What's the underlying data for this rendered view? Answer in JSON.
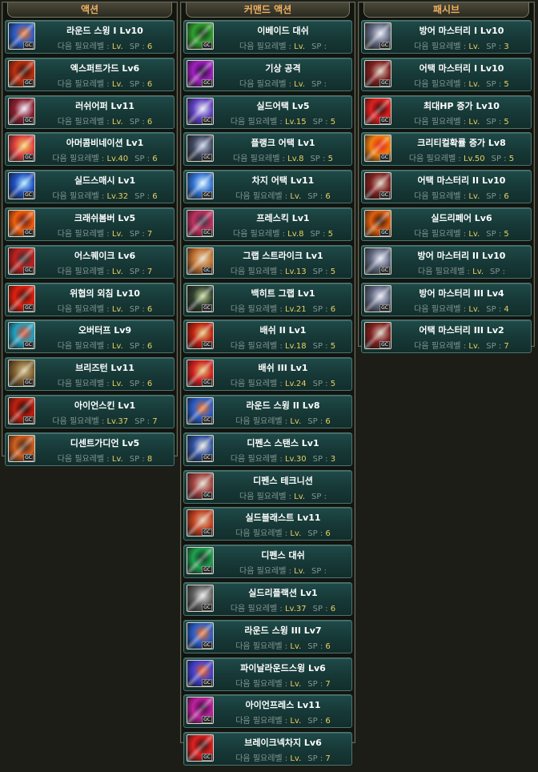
{
  "colors": {
    "title": "#f0b060",
    "skill_name": "#ffffff",
    "req_label": "#7f9693",
    "req_value": "#e8d060"
  },
  "req_label": "다음 필요레벨 :",
  "lv_prefix": "Lv.",
  "sp_label": "SP :",
  "gc_badge": "GC",
  "columns": [
    {
      "title": "액션",
      "skills": [
        {
          "name": "라운드 스윙 I Lv10",
          "lv": "",
          "sp": "6",
          "icon": "sword-swing-icon",
          "c1": "#2a5cc8",
          "c2": "#f07020"
        },
        {
          "name": "엑스퍼트가드 Lv6",
          "lv": "",
          "sp": "6",
          "icon": "guard-icon",
          "c1": "#c03010",
          "c2": "#301008"
        },
        {
          "name": "러쉬어퍼 Lv11",
          "lv": "",
          "sp": "6",
          "icon": "uppercut-icon",
          "c1": "#8a2030",
          "c2": "#e8e0f0"
        },
        {
          "name": "아머콤비네이션 Lv1",
          "lv": "40",
          "sp": "6",
          "icon": "armor-combo-icon",
          "c1": "#e04040",
          "c2": "#f0d060"
        },
        {
          "name": "실드스매시 Lv1",
          "lv": "32",
          "sp": "6",
          "icon": "shield-smash-icon",
          "c1": "#2050c0",
          "c2": "#a0e0ff"
        },
        {
          "name": "크래쉬봄버 Lv5",
          "lv": "",
          "sp": "7",
          "icon": "crash-bomber-icon",
          "c1": "#f06010",
          "c2": "#601008"
        },
        {
          "name": "어스퀘이크 Lv6",
          "lv": "",
          "sp": "7",
          "icon": "earthquake-icon",
          "c1": "#c02020",
          "c2": "#303030"
        },
        {
          "name": "위협의 외침 Lv10",
          "lv": "",
          "sp": "6",
          "icon": "war-cry-icon",
          "c1": "#e02010",
          "c2": "#401008"
        },
        {
          "name": "오버터프 Lv9",
          "lv": "",
          "sp": "6",
          "icon": "overtough-icon",
          "c1": "#20a0c0",
          "c2": "#e04020"
        },
        {
          "name": "브리즈턴 Lv11",
          "lv": "",
          "sp": "6",
          "icon": "breeze-turn-icon",
          "c1": "#806030",
          "c2": "#d0c090"
        },
        {
          "name": "아이언스킨 Lv1",
          "lv": "37",
          "sp": "7",
          "icon": "iron-skin-icon",
          "c1": "#c02010",
          "c2": "#200808"
        },
        {
          "name": "디센트가디언 Lv5",
          "lv": "",
          "sp": "8",
          "icon": "decent-guardian-icon",
          "c1": "#d06020",
          "c2": "#402010"
        }
      ]
    },
    {
      "title": "커맨드 액션",
      "skills": [
        {
          "name": "이베이드 대쉬",
          "lv": "",
          "sp": "",
          "icon": "evade-dash-icon",
          "c1": "#30a030",
          "c2": "#103010"
        },
        {
          "name": "기상 공격",
          "lv": "",
          "sp": "",
          "icon": "wake-attack-icon",
          "c1": "#a020c0",
          "c2": "#200830"
        },
        {
          "name": "실드어택 Lv5",
          "lv": "15",
          "sp": "5",
          "icon": "shield-attack-icon",
          "c1": "#6040c0",
          "c2": "#e0e0f0"
        },
        {
          "name": "플랭크 어택 Lv1",
          "lv": "8",
          "sp": "5",
          "icon": "flank-attack-icon",
          "c1": "#404860",
          "c2": "#c0c8e0"
        },
        {
          "name": "차지 어택 Lv11",
          "lv": "",
          "sp": "6",
          "icon": "charge-attack-icon",
          "c1": "#3070d0",
          "c2": "#d0f0ff"
        },
        {
          "name": "프레스킥 Lv1",
          "lv": "8",
          "sp": "5",
          "icon": "press-kick-icon",
          "c1": "#c03060",
          "c2": "#303040"
        },
        {
          "name": "그랩 스트라이크 Lv1",
          "lv": "13",
          "sp": "5",
          "icon": "grab-strike-icon",
          "c1": "#c07030",
          "c2": "#e0d0b0"
        },
        {
          "name": "백히트 그랩 Lv1",
          "lv": "21",
          "sp": "6",
          "icon": "back-hit-grab-icon",
          "c1": "#304030",
          "c2": "#c0d090"
        },
        {
          "name": "배쉬 II Lv1",
          "lv": "18",
          "sp": "5",
          "icon": "bash-2-icon",
          "c1": "#c02010",
          "c2": "#e0c070"
        },
        {
          "name": "배쉬 III Lv1",
          "lv": "24",
          "sp": "5",
          "icon": "bash-3-icon",
          "c1": "#d02020",
          "c2": "#e0c070"
        },
        {
          "name": "라운드 스윙 II Lv8",
          "lv": "",
          "sp": "6",
          "icon": "round-swing-2-icon",
          "c1": "#2a5cc8",
          "c2": "#f07020"
        },
        {
          "name": "디펜스 스탠스 Lv1",
          "lv": "30",
          "sp": "3",
          "icon": "defense-stance-icon",
          "c1": "#3050a0",
          "c2": "#e0e0e0"
        },
        {
          "name": "디펜스 테크니션",
          "lv": "",
          "sp": "",
          "icon": "defense-technician-icon",
          "c1": "#a04040",
          "c2": "#e0d0c0"
        },
        {
          "name": "실드블래스트 Lv11",
          "lv": "",
          "sp": "6",
          "icon": "shield-blast-icon",
          "c1": "#c04020",
          "c2": "#e0c0a0"
        },
        {
          "name": "디펜스 대쉬",
          "lv": "",
          "sp": "",
          "icon": "defense-dash-icon",
          "c1": "#20a050",
          "c2": "#102818"
        },
        {
          "name": "실드리플랙션 Lv1",
          "lv": "37",
          "sp": "6",
          "icon": "shield-reflection-icon",
          "c1": "#606060",
          "c2": "#e0e0e0"
        },
        {
          "name": "라운드 스윙 III Lv7",
          "lv": "",
          "sp": "6",
          "icon": "round-swing-3-icon",
          "c1": "#2a5cc8",
          "c2": "#f07020"
        },
        {
          "name": "파이날라운드스윙 Lv6",
          "lv": "",
          "sp": "7",
          "icon": "final-round-swing-icon",
          "c1": "#4040d0",
          "c2": "#f06020"
        },
        {
          "name": "아이언프레스 Lv11",
          "lv": "",
          "sp": "6",
          "icon": "iron-press-icon",
          "c1": "#c020a0",
          "c2": "#300830"
        },
        {
          "name": "브레이크넥차지 Lv6",
          "lv": "",
          "sp": "7",
          "icon": "breakneck-charge-icon",
          "c1": "#e02020",
          "c2": "#301010"
        }
      ]
    },
    {
      "title": "패시브",
      "skills": [
        {
          "name": "방어 마스터리 I Lv10",
          "lv": "",
          "sp": "3",
          "icon": "defense-mastery-1-icon",
          "c1": "#606880",
          "c2": "#e0e0f0"
        },
        {
          "name": "어택 마스터리 I Lv10",
          "lv": "",
          "sp": "5",
          "icon": "attack-mastery-1-icon",
          "c1": "#802020",
          "c2": "#d0c0b0"
        },
        {
          "name": "최대HP 증가 Lv10",
          "lv": "",
          "sp": "5",
          "icon": "max-hp-icon",
          "c1": "#e02020",
          "c2": "#300808"
        },
        {
          "name": "크리티컬확률 증가 Lv8",
          "lv": "50",
          "sp": "5",
          "icon": "critical-rate-icon",
          "c1": "#f08010",
          "c2": "#e02010"
        },
        {
          "name": "어택 마스터리 II Lv10",
          "lv": "",
          "sp": "6",
          "icon": "attack-mastery-2-icon",
          "c1": "#802020",
          "c2": "#d0c0b0"
        },
        {
          "name": "실드리페어 Lv6",
          "lv": "",
          "sp": "5",
          "icon": "shield-repair-icon",
          "c1": "#e06010",
          "c2": "#301008"
        },
        {
          "name": "방어 마스터리 II Lv10",
          "lv": "",
          "sp": "",
          "icon": "defense-mastery-2-icon",
          "c1": "#606880",
          "c2": "#e0e0f0"
        },
        {
          "name": "방어 마스터리 III Lv4",
          "lv": "",
          "sp": "4",
          "icon": "defense-mastery-3-icon",
          "c1": "#606880",
          "c2": "#e0e0f0"
        },
        {
          "name": "어택 마스터리 III Lv2",
          "lv": "",
          "sp": "7",
          "icon": "attack-mastery-3-icon",
          "c1": "#802020",
          "c2": "#d0c0b0"
        }
      ]
    }
  ]
}
